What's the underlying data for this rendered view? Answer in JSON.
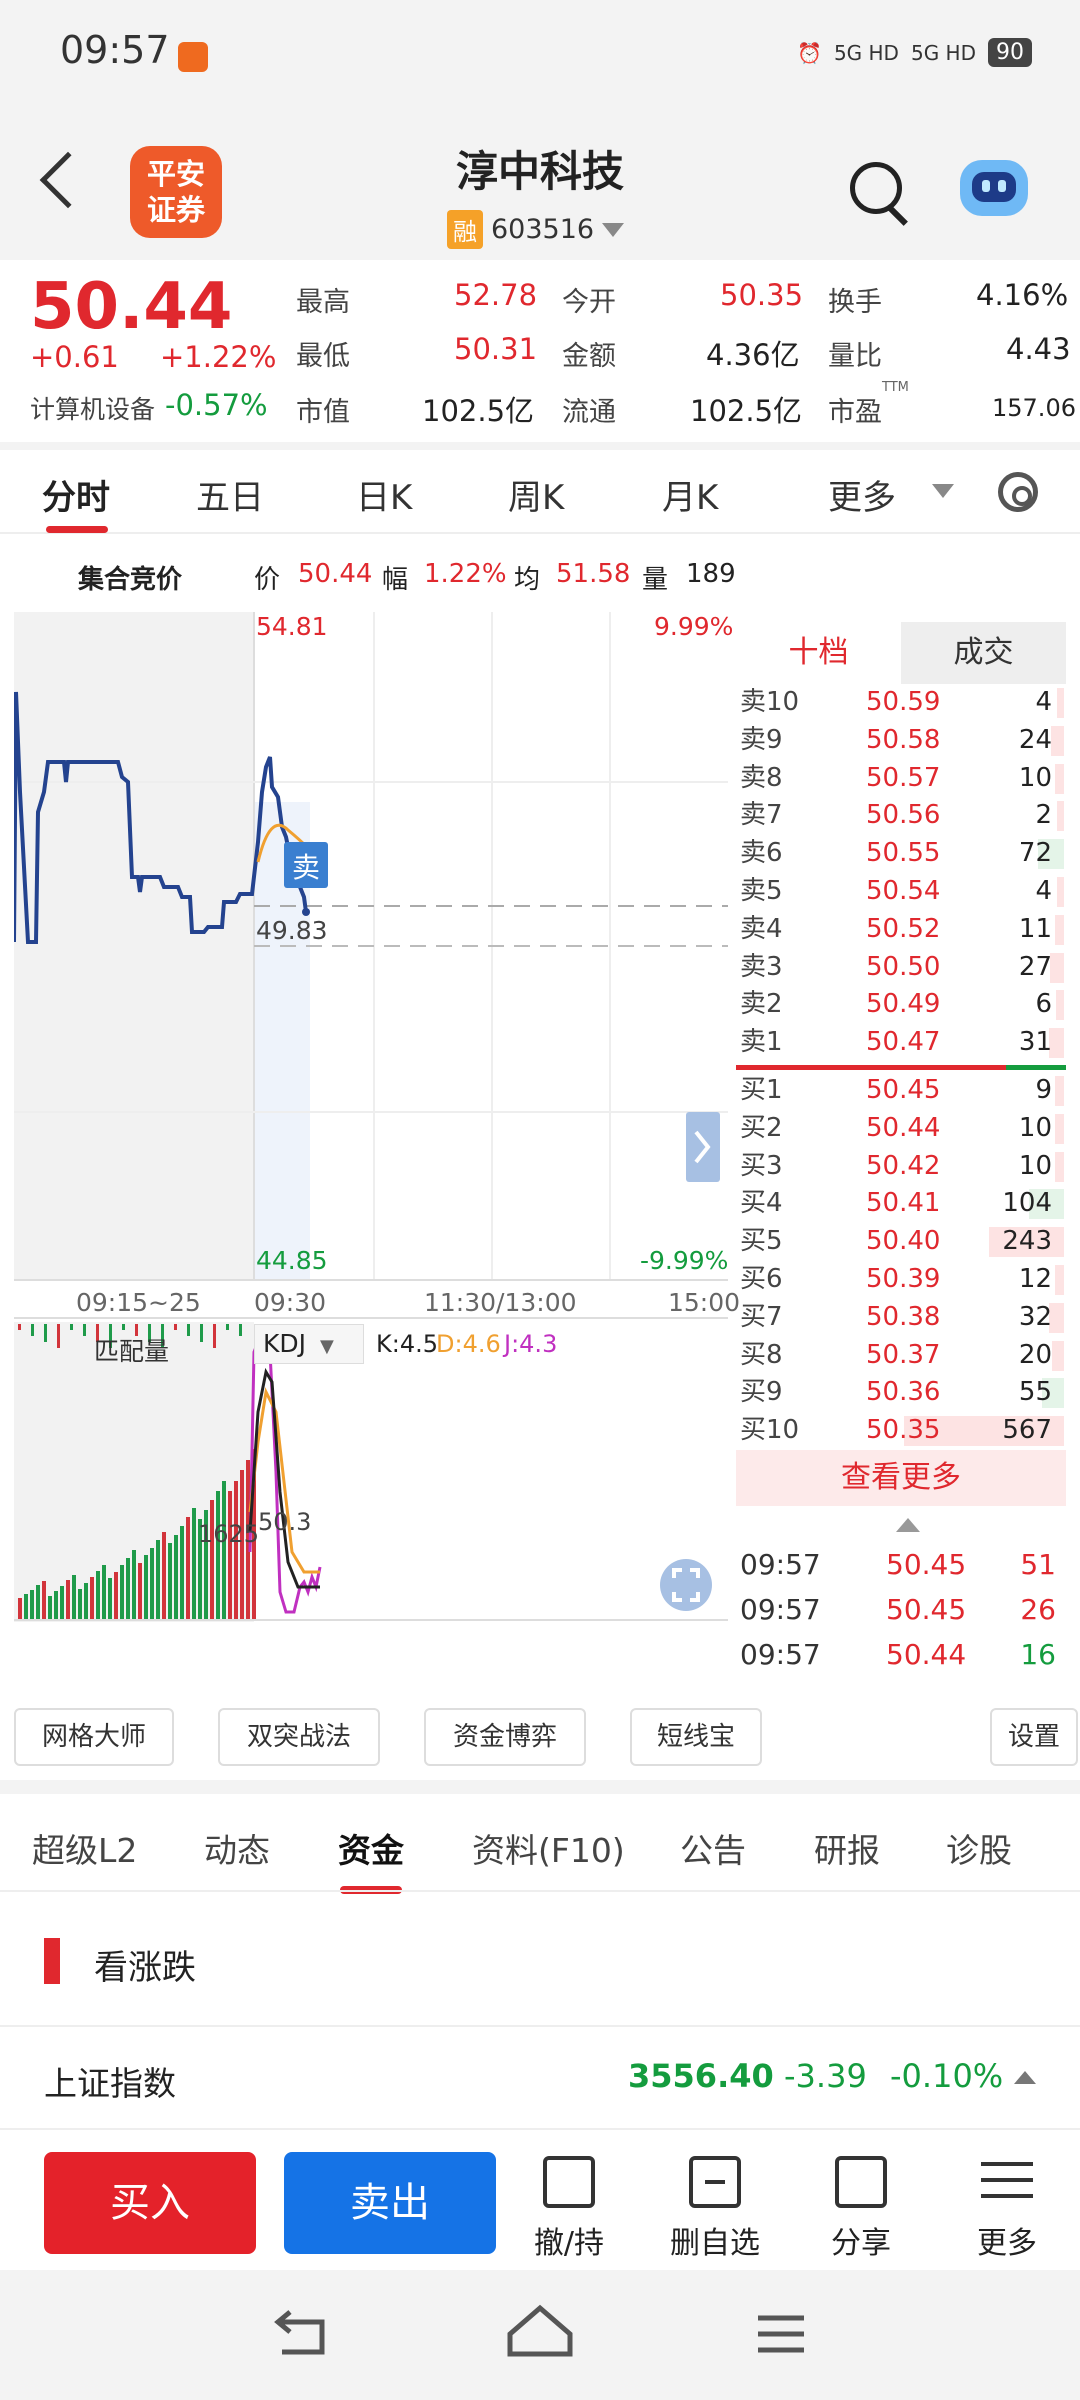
{
  "status": {
    "time": "09:57",
    "signal1": "5G HD",
    "signal2": "5G HD",
    "battery": "90"
  },
  "header": {
    "logo_line1": "平安",
    "logo_line2": "证券",
    "name": "淳中科技",
    "badge": "融",
    "code": "603516"
  },
  "quote": {
    "price": "50.44",
    "change": "+0.61",
    "change_pct": "+1.22%",
    "sector": "计算机设备",
    "sector_pct": "-0.57%",
    "high_label": "最高",
    "high": "52.78",
    "low_label": "最低",
    "low": "50.31",
    "mcap_label": "市值",
    "mcap": "102.5亿",
    "open_label": "今开",
    "open": "50.35",
    "amount_label": "金额",
    "amount": "4.36亿",
    "float_label": "流通",
    "float": "102.5亿",
    "turnover_label": "换手",
    "turnover": "4.16%",
    "volratio_label": "量比",
    "volratio": "4.43",
    "pe_label": "市盈",
    "pe_sup": "TTM",
    "pe": "157.06"
  },
  "ktabs": {
    "items": [
      "分时",
      "五日",
      "日K",
      "周K",
      "月K",
      "更多"
    ]
  },
  "infoline": {
    "label": "集合竞价",
    "price_label": "价",
    "price": "50.44",
    "amp_label": "幅",
    "amp": "1.22%",
    "avg_label": "均",
    "avg": "51.58",
    "vol_label": "量",
    "vol": "189"
  },
  "chart": {
    "top_price": "54.81",
    "top_pct": "9.99%",
    "bottom_price": "44.85",
    "bottom_pct": "-9.99%",
    "mid_price": "49.83",
    "sell_marker": "卖",
    "times": [
      "09:15~25",
      "09:30",
      "11:30/13:00",
      "15:00"
    ],
    "sub_label": "匹配量",
    "indicator": "KDJ",
    "k_text": "K:4.5",
    "d_text": "D:4.6",
    "j_text": "J:4.3",
    "sub_val1": "1625",
    "sub_val2": "50.3",
    "colors": {
      "price_line": "#24438f",
      "avg_line": "#f0a030",
      "k": "#222222",
      "d": "#f0a030",
      "j": "#c030c0"
    }
  },
  "book": {
    "tab_active": "十档",
    "tab_other": "成交",
    "asks": [
      {
        "label": "卖10",
        "price": "50.59",
        "vol": "4"
      },
      {
        "label": "卖9",
        "price": "50.58",
        "vol": "24"
      },
      {
        "label": "卖8",
        "price": "50.57",
        "vol": "10"
      },
      {
        "label": "卖7",
        "price": "50.56",
        "vol": "2"
      },
      {
        "label": "卖6",
        "price": "50.55",
        "vol": "72"
      },
      {
        "label": "卖5",
        "price": "50.54",
        "vol": "4"
      },
      {
        "label": "卖4",
        "price": "50.52",
        "vol": "11"
      },
      {
        "label": "卖3",
        "price": "50.50",
        "vol": "27"
      },
      {
        "label": "卖2",
        "price": "50.49",
        "vol": "6"
      },
      {
        "label": "卖1",
        "price": "50.47",
        "vol": "31"
      }
    ],
    "bids": [
      {
        "label": "买1",
        "price": "50.45",
        "vol": "9"
      },
      {
        "label": "买2",
        "price": "50.44",
        "vol": "10"
      },
      {
        "label": "买3",
        "price": "50.42",
        "vol": "10"
      },
      {
        "label": "买4",
        "price": "50.41",
        "vol": "104"
      },
      {
        "label": "买5",
        "price": "50.40",
        "vol": "243"
      },
      {
        "label": "买6",
        "price": "50.39",
        "vol": "12"
      },
      {
        "label": "买7",
        "price": "50.38",
        "vol": "32"
      },
      {
        "label": "买8",
        "price": "50.37",
        "vol": "20"
      },
      {
        "label": "买9",
        "price": "50.36",
        "vol": "55"
      },
      {
        "label": "买10",
        "price": "50.35",
        "vol": "567"
      }
    ],
    "more": "查看更多",
    "trades": [
      {
        "time": "09:57",
        "price": "50.45",
        "vol": "51",
        "dir": "up"
      },
      {
        "time": "09:57",
        "price": "50.45",
        "vol": "26",
        "dir": "up"
      },
      {
        "time": "09:57",
        "price": "50.44",
        "vol": "16",
        "dir": "down"
      }
    ]
  },
  "tools": {
    "items": [
      "网格大师",
      "双突战法",
      "资金博弈",
      "短线宝"
    ],
    "settings": "设置"
  },
  "lowtabs": {
    "items": [
      "超级L2",
      "动态",
      "资金",
      "资料(F10)",
      "公告",
      "研报",
      "诊股"
    ]
  },
  "section": {
    "title": "看涨跌"
  },
  "index": {
    "name": "上证指数",
    "value": "3556.40",
    "change": "-3.39",
    "pct": "-0.10%"
  },
  "actions": {
    "buy": "买入",
    "sell": "卖出",
    "items": [
      "撤/持",
      "删自选",
      "分享",
      "更多"
    ]
  }
}
